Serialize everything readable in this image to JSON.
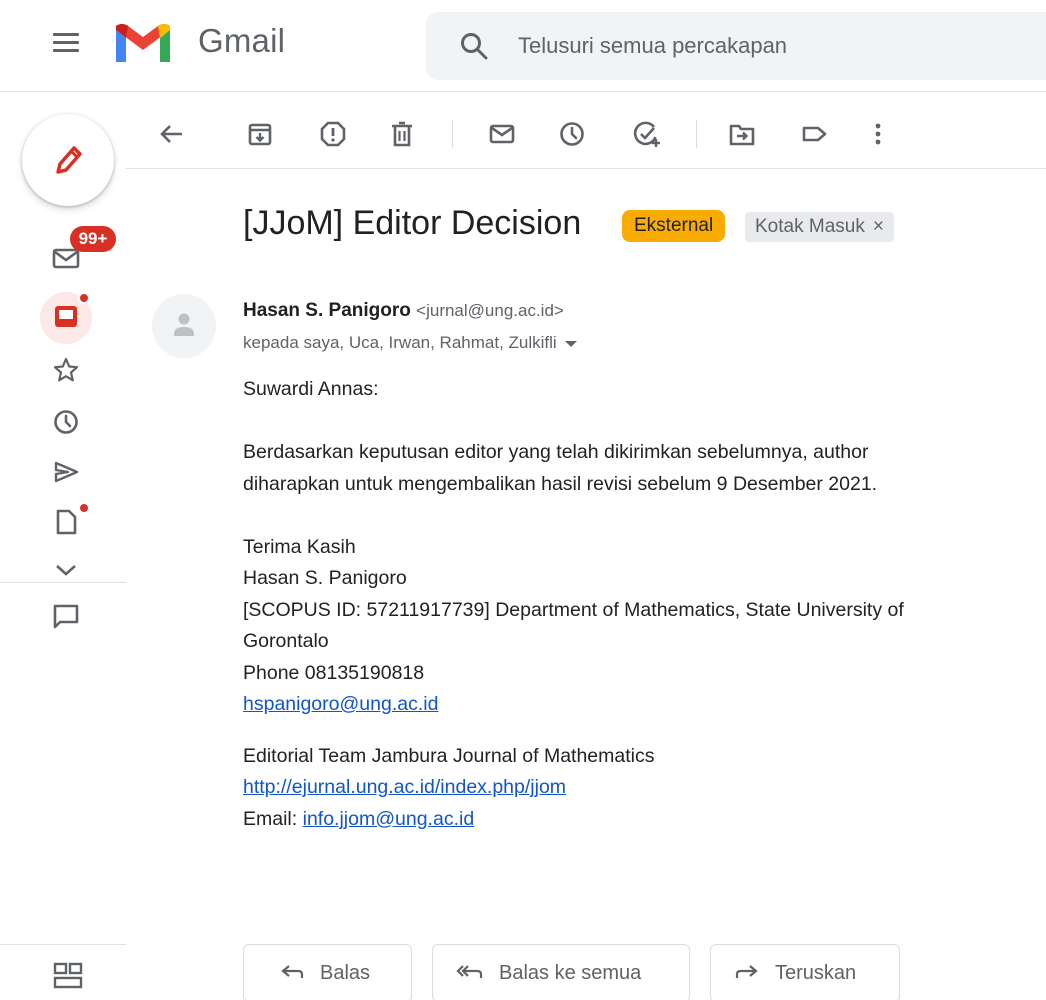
{
  "header": {
    "app_name": "Gmail",
    "search_placeholder": "Telusuri semua percakapan"
  },
  "sidebar": {
    "unread_badge": "99+",
    "items": [
      {
        "icon": "mail-icon"
      },
      {
        "icon": "inbox-icon",
        "dot": true
      },
      {
        "icon": "star-icon"
      },
      {
        "icon": "snoozed-clock-icon"
      },
      {
        "icon": "sent-icon"
      },
      {
        "icon": "draft-icon",
        "dot": true
      },
      {
        "icon": "chevron-down-icon"
      },
      {
        "icon": "chat-icon"
      },
      {
        "icon": "apps-grid-icon"
      }
    ]
  },
  "toolbar": {
    "icons": [
      "back-arrow-icon",
      "archive-icon",
      "report-spam-icon",
      "delete-icon",
      "mark-unread-icon",
      "snooze-icon",
      "add-task-icon",
      "move-to-icon",
      "label-icon",
      "more-icon"
    ]
  },
  "email": {
    "subject": "[JJoM] Editor Decision",
    "label_external": "Eksternal",
    "label_inbox": "Kotak Masuk",
    "label_remove": "×",
    "sender_name": "Hasan S. Panigoro",
    "sender_email": "<jurnal@ung.ac.id>",
    "recipients": "kepada saya, Uca, Irwan, Rahmat, Zulkifli",
    "body": {
      "greeting": "Suwardi Annas:",
      "paragraph_line1": "Berdasarkan keputusan editor yang telah dikirimkan sebelumnya, author",
      "paragraph_line2": "diharapkan untuk mengembalikan hasil revisi sebelum 9 Desember 2021.",
      "closing": "Terima Kasih",
      "signature_name": "Hasan S. Panigoro",
      "signature_affiliation": "[SCOPUS ID: 57211917739] Department of Mathematics, State University of Gorontalo",
      "signature_phone": "Phone 08135190818",
      "signature_email": "hspanigoro@ung.ac.id",
      "separator": "________________________________________________________________________________",
      "team": "Editorial Team Jambura Journal of Mathematics",
      "journal_url": "http://ejurnal.ung.ac.id/index.php/jjom",
      "contact_prefix": "Email: ",
      "contact_email": "info.jjom@ung.ac.id"
    }
  },
  "actions": {
    "reply": "Balas",
    "reply_all": "Balas ke semua",
    "forward": "Teruskan"
  },
  "colors": {
    "accent_red": "#d93025",
    "external_label": "#f9ab00",
    "link": "#1155cc"
  }
}
